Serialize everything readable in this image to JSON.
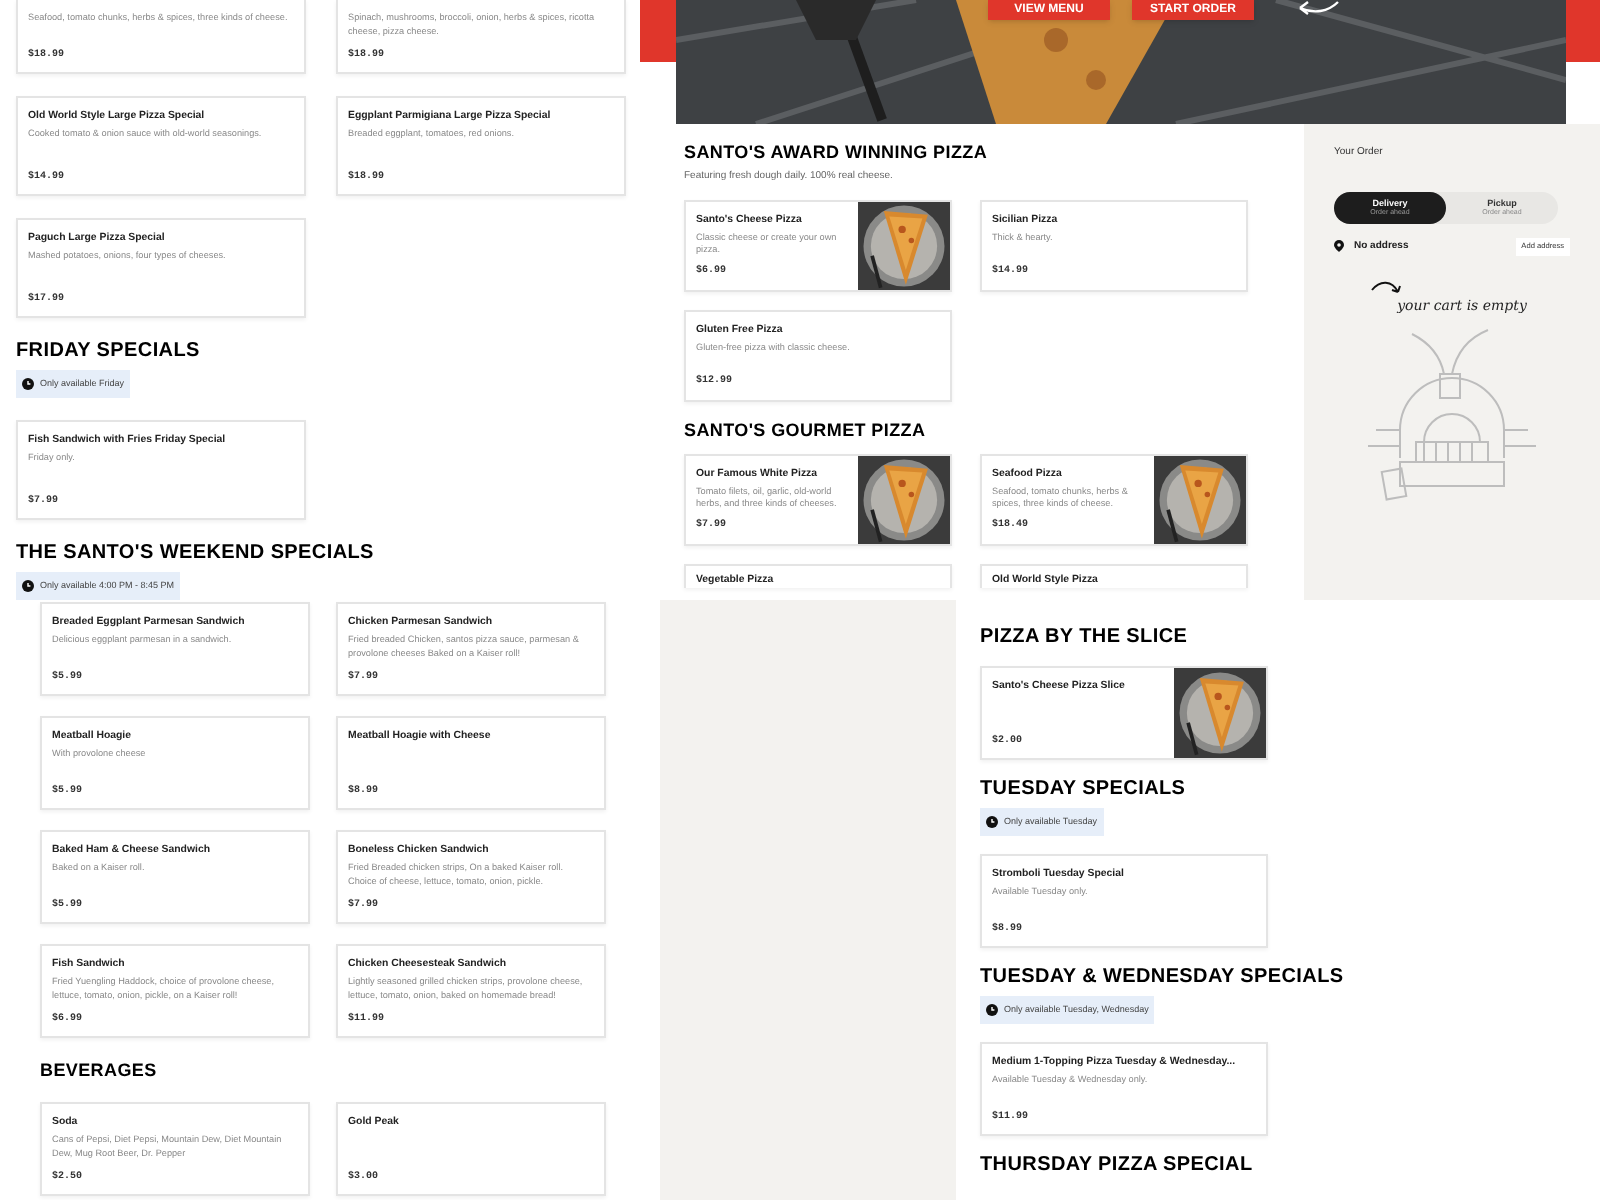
{
  "panels": [
    {
      "sections": [
        {
          "cards": [
            {
              "description": "Seafood, tomato chunks, herbs & spices, three kinds of cheese.",
              "price": "$18.99"
            },
            {
              "description": "Spinach, mushrooms, broccoli, onion, herbs & spices, ricotta cheese, pizza cheese.",
              "price": "$18.99"
            }
          ]
        },
        {
          "cards": [
            {
              "title": "Old World Style Large Pizza Special",
              "description": "Cooked tomato & onion sauce with old-world seasonings.",
              "price": "$14.99"
            },
            {
              "title": "Eggplant Parmigiana Large Pizza Special",
              "description": "Breaded eggplant, tomatoes, red onions.",
              "price": "$18.99"
            },
            {
              "title": "Paguch Large Pizza Special",
              "description": "Mashed potatoes, onions, four types of cheeses.",
              "price": "$17.99"
            }
          ]
        },
        {
          "heading": "FRIDAY SPECIALS",
          "availability": "Only available Friday",
          "cards": [
            {
              "title": "Fish Sandwich with Fries Friday Special",
              "description": "Friday only.",
              "price": "$7.99"
            }
          ]
        },
        {
          "heading": "THE SANTO'S WEEKEND SPECIALS",
          "availability": "Only available 4:00 PM - 8:45 PM"
        }
      ]
    },
    {
      "sections": [
        {
          "cards": [
            {
              "title": "Breaded Eggplant Parmesan Sandwich",
              "description": "Delicious eggplant parmesan in a sandwich.",
              "price": "$5.99"
            },
            {
              "title": "Chicken Parmesan Sandwich",
              "description": "Fried breaded Chicken, santos pizza sauce, parmesan & provolone cheeses Baked on a Kaiser roll!",
              "price": "$7.99"
            },
            {
              "title": "Meatball Hoagie",
              "description": "With provolone cheese",
              "price": "$5.99"
            },
            {
              "title": "Meatball Hoagie with Cheese",
              "price": "$8.99"
            },
            {
              "title": "Baked Ham & Cheese Sandwich",
              "description": "Baked on a Kaiser roll.",
              "price": "$5.99"
            },
            {
              "title": "Boneless Chicken Sandwich",
              "description": "Fried Breaded chicken strips, On a baked Kaiser roll. Choice of cheese, lettuce, tomato, onion, pickle.",
              "price": "$7.99"
            },
            {
              "title": "Fish Sandwich",
              "description": "Fried Yuengling Haddock, choice of provolone cheese, lettuce, tomato, onion, pickle, on a Kaiser roll!",
              "price": "$6.99"
            },
            {
              "title": "Chicken Cheesesteak Sandwich",
              "description": "Lightly seasoned grilled chicken strips, provolone cheese, lettuce, tomato, onion, baked on homemade bread!",
              "price": "$11.99"
            }
          ]
        },
        {
          "heading": "BEVERAGES",
          "cards": [
            {
              "title": "Soda",
              "description": "Cans of Pepsi, Diet Pepsi, Mountain Dew, Diet Mountain Dew, Mug Root Beer, Dr. Pepper",
              "price": "$2.50"
            },
            {
              "title": "Gold Peak",
              "price": "$3.00"
            }
          ]
        }
      ]
    },
    {
      "hero_buttons": [
        "VIEW MENU",
        "START ORDER"
      ],
      "sections": [
        {
          "heading": "SANTO'S AWARD WINNING PIZZA",
          "subtitle": "Featuring fresh dough daily. 100% real cheese.",
          "cards": [
            {
              "title": "Santo's Cheese Pizza",
              "description": "Classic cheese or create your own pizza.",
              "price": "$6.99",
              "kind": "picture"
            },
            {
              "title": "Sicilian Pizza",
              "description": "Thick & hearty.",
              "price": "$14.99"
            },
            {
              "title": "Gluten Free Pizza",
              "description": "Gluten-free pizza with classic cheese.",
              "price": "$12.99"
            }
          ]
        },
        {
          "heading": "SANTO'S GOURMET PIZZA",
          "cards": [
            {
              "title": "Our Famous White Pizza",
              "description": "Tomato filets, oil, garlic, old-world herbs, and three kinds of cheeses.",
              "price": "$7.99",
              "kind": "picture"
            },
            {
              "title": "Seafood Pizza",
              "description": "Seafood, tomato chunks, herbs & spices, three kinds of cheese.",
              "price": "$18.49",
              "kind": "picture"
            },
            {
              "title": "Vegetable Pizza"
            },
            {
              "title": "Old World Style Pizza"
            }
          ]
        }
      ],
      "order": {
        "title": "Your Order",
        "modes": [
          {
            "label": "Delivery",
            "sub": "Order ahead",
            "selected": true
          },
          {
            "label": "Pickup",
            "sub": "Order ahead",
            "selected": false
          }
        ],
        "address": "No address",
        "address_button": "Add address",
        "empty_note": "your cart is empty"
      }
    },
    {
      "sections": [
        {
          "heading": "PIZZA BY THE SLICE",
          "cards": [
            {
              "title": "Santo's Cheese Pizza Slice",
              "price": "$2.00",
              "kind": "picture"
            }
          ]
        },
        {
          "heading": "TUESDAY SPECIALS",
          "availability": "Only available Tuesday",
          "cards": [
            {
              "title": "Stromboli Tuesday Special",
              "description": "Available Tuesday only.",
              "price": "$8.99"
            }
          ]
        },
        {
          "heading": "TUESDAY & WEDNESDAY SPECIALS",
          "availability": "Only available Tuesday, Wednesday",
          "cards": [
            {
              "title": "Medium 1-Topping Pizza Tuesday & Wednesday...",
              "description": "Available Tuesday & Wednesday only.",
              "price": "$11.99"
            }
          ]
        },
        {
          "heading": "THURSDAY PIZZA SPECIAL"
        }
      ]
    }
  ]
}
